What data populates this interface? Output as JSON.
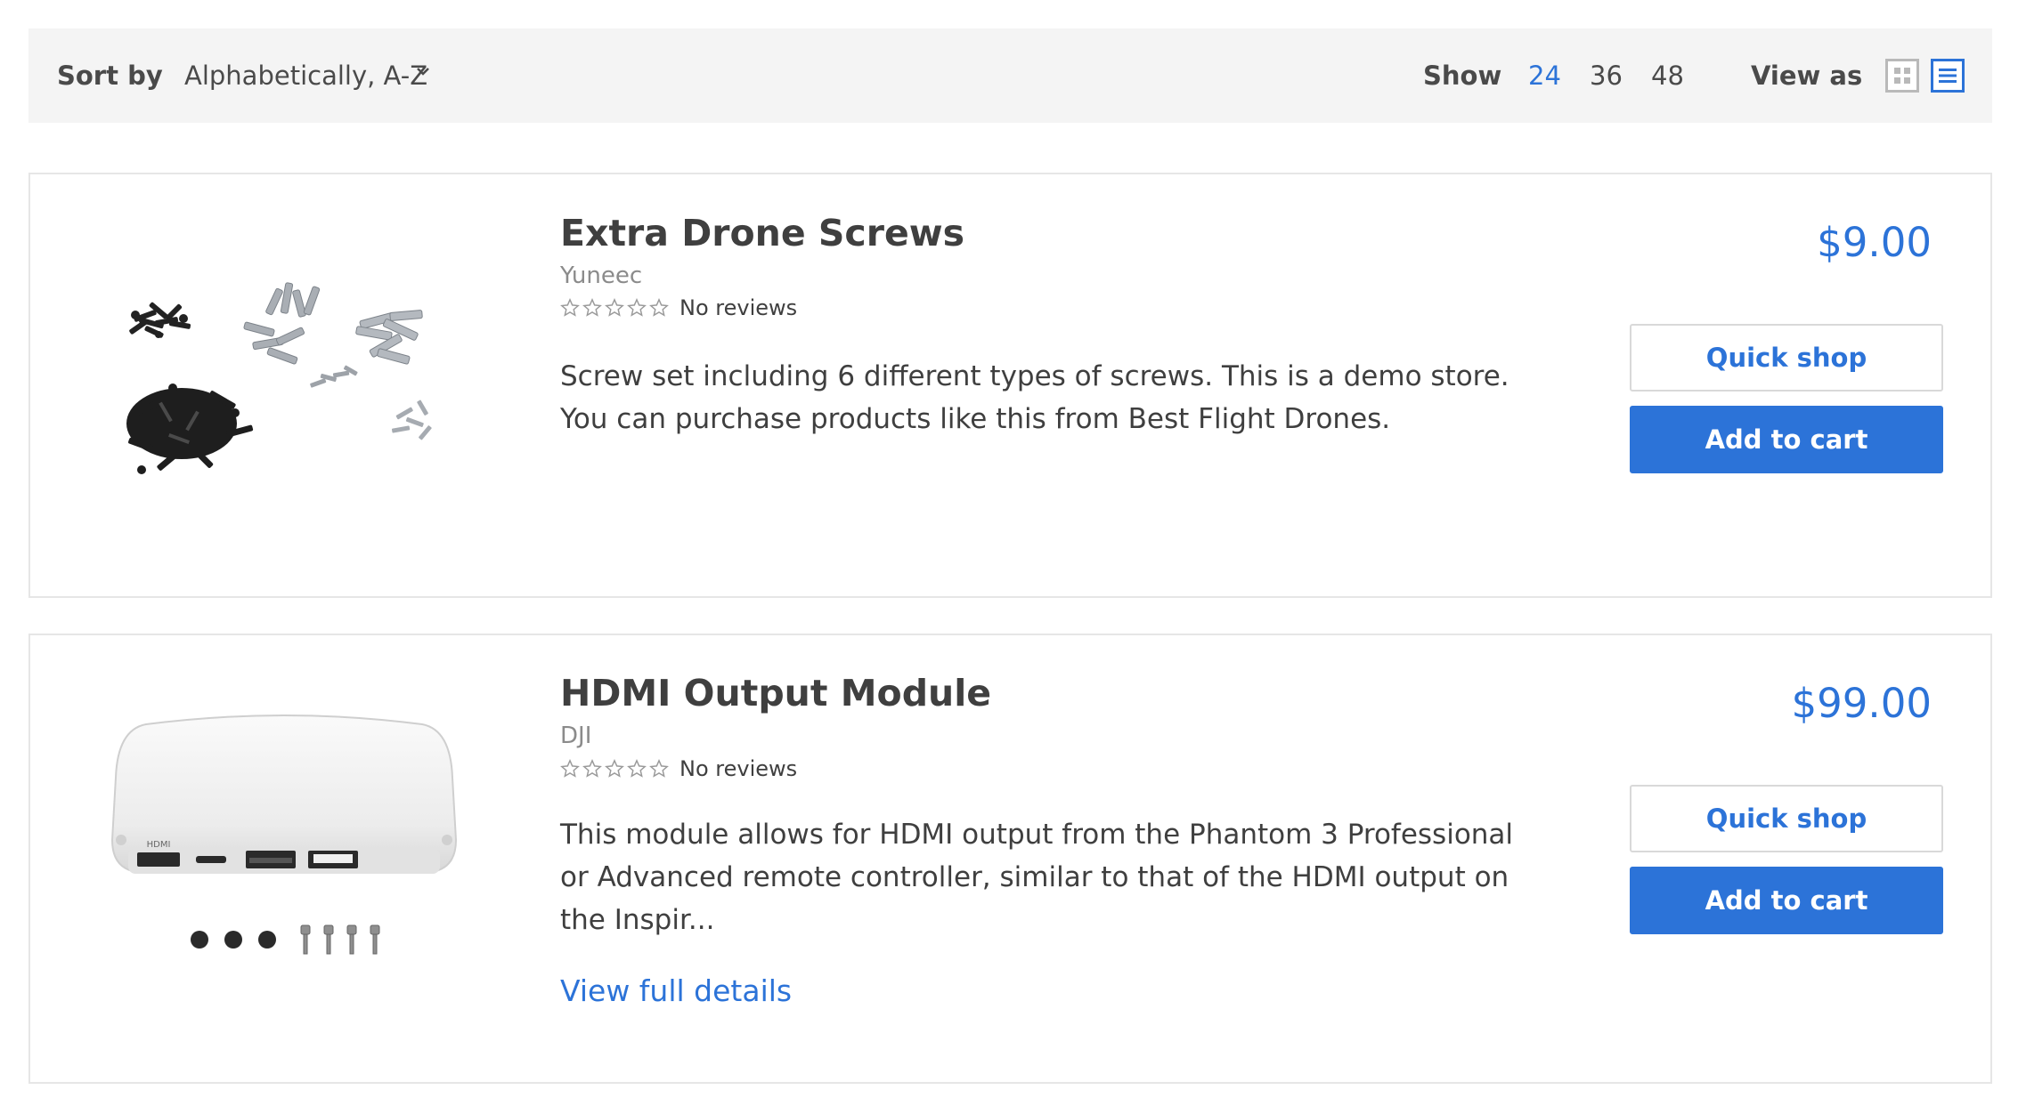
{
  "toolbar": {
    "sort_label": "Sort by",
    "sort_value": "Alphabetically, A-Z",
    "show_label": "Show",
    "show_options": [
      "24",
      "36",
      "48"
    ],
    "show_selected": "24",
    "view_label": "View as",
    "view_modes": [
      "grid-icon",
      "list-icon"
    ],
    "view_selected": "list"
  },
  "products": [
    {
      "title": "Extra Drone Screws",
      "vendor": "Yuneec",
      "reviews": "No reviews",
      "rating": 0,
      "description": "Screw set including 6 different types of screws. This is a demo store. You can purchase products like this from Best Flight Drones.",
      "price": "$9.00",
      "quick_shop": "Quick shop",
      "add_to_cart": "Add to cart"
    },
    {
      "title": "HDMI Output Module",
      "vendor": "DJI",
      "reviews": "No reviews",
      "rating": 0,
      "description": "This module allows for HDMI output from the Phantom 3 Professional or Advanced remote controller, similar to that of the HDMI output on the Inspir...",
      "price": "$99.00",
      "quick_shop": "Quick shop",
      "add_to_cart": "Add to cart",
      "details_link": "View full details",
      "port_label": "HDMI"
    }
  ],
  "colors": {
    "accent": "#2c73d8",
    "toolbar_bg": "#f4f4f4",
    "text": "#3f3f3f",
    "muted": "#8b8b8b",
    "border": "#e6e6e6"
  }
}
